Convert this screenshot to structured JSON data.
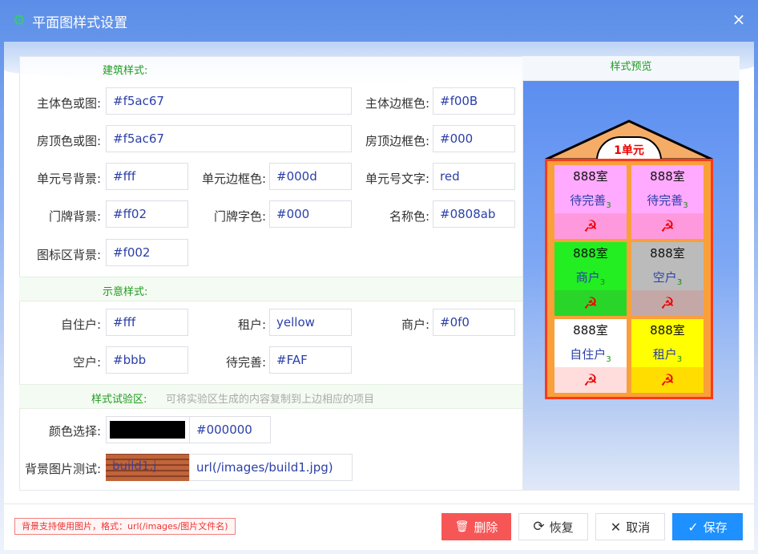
{
  "window": {
    "title": "平面图样式设置",
    "close": "×"
  },
  "sections": {
    "building": "建筑样式:",
    "preview": "样式预览",
    "legend": "示意样式:",
    "test": "样式试验区:",
    "test_hint": "可将实验区生成的内容复制到上边相应的项目"
  },
  "building": {
    "main_color": {
      "label": "主体色或图:",
      "value": "#f5ac67"
    },
    "main_border": {
      "label": "主体边框色:",
      "value": "#f00B"
    },
    "roof_color": {
      "label": "房顶色或图:",
      "value": "#f5ac67"
    },
    "roof_border": {
      "label": "房顶边框色:",
      "value": "#000"
    },
    "unit_bg": {
      "label": "单元号背景:",
      "value": "#fff"
    },
    "unit_border": {
      "label": "单元边框色:",
      "value": "#000d"
    },
    "unit_text": {
      "label": "单元号文字:",
      "value": "red"
    },
    "plate_bg": {
      "label": "门牌背景:",
      "value": "#ff02"
    },
    "plate_text": {
      "label": "门牌字色:",
      "value": "#000"
    },
    "name_color": {
      "label": "名称色:",
      "value": "#0808ab"
    },
    "icon_bg": {
      "label": "图标区背景:",
      "value": "#f002"
    }
  },
  "legend": {
    "owner": {
      "label": "自住户:",
      "value": "#fff"
    },
    "tenant": {
      "label": "租户:",
      "value": "yellow"
    },
    "shop": {
      "label": "商户:",
      "value": "#0f0"
    },
    "vacant": {
      "label": "空户:",
      "value": "#bbb"
    },
    "pending": {
      "label": "待完善:",
      "value": "#FAF"
    }
  },
  "test": {
    "color_label": "颜色选择:",
    "color_value": "#000000",
    "bg_label": "背景图片测试:",
    "bg_overlay": "build1.j",
    "bg_value": "url(/images/build1.jpg)"
  },
  "preview": {
    "unit_label": "1单元",
    "cells": [
      {
        "room": "888室",
        "name": "待完善",
        "sub": "3",
        "icon": "☭",
        "bg": "#ffaaff",
        "bg2": "#ff99dd"
      },
      {
        "room": "888室",
        "name": "待完善",
        "sub": "3",
        "icon": "☭",
        "bg": "#ffaaff",
        "bg2": "#ff99dd"
      },
      {
        "room": "888室",
        "name": "商户",
        "sub": "3",
        "icon": "☭",
        "bg": "#22ee22",
        "bg2": "#2ad52a"
      },
      {
        "room": "888室",
        "name": "空户",
        "sub": "3",
        "icon": "☭",
        "bg": "#bbbbbb",
        "bg2": "#c4a8a8"
      },
      {
        "room": "888室",
        "name": "自住户",
        "sub": "3",
        "icon": "☭",
        "bg": "#ffffff",
        "bg2": "#ffdddd"
      },
      {
        "room": "888室",
        "name": "租户",
        "sub": "3",
        "icon": "☭",
        "bg": "#ffff00",
        "bg2": "#ffdd00"
      }
    ]
  },
  "footer": {
    "note": "背景支持使用图片，格式：url(/images/图片文件名)",
    "delete": "删除",
    "restore": "恢复",
    "cancel": "取消",
    "save": "保存"
  },
  "colors": {
    "accent": "#1e90ff",
    "danger": "#f75656",
    "section_green": "#1f9a1f"
  }
}
